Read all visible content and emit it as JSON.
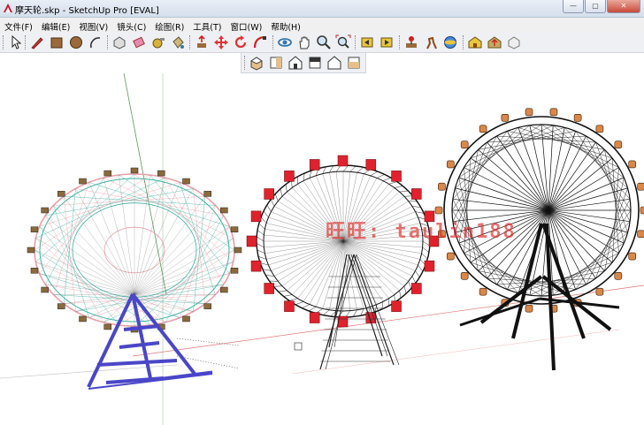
{
  "window": {
    "title": "摩天轮.skp - SketchUp Pro [EVAL]",
    "minimize": "—",
    "maximize": "▢",
    "close": "✕"
  },
  "menubar": [
    {
      "label": "文件(F)"
    },
    {
      "label": "编辑(E)"
    },
    {
      "label": "视图(V)"
    },
    {
      "label": "镜头(C)"
    },
    {
      "label": "绘图(R)"
    },
    {
      "label": "工具(T)"
    },
    {
      "label": "窗口(W)"
    },
    {
      "label": "帮助(H)"
    }
  ],
  "toolbar_icons": [
    "select-icon",
    "pencil-icon",
    "rectangle-icon",
    "circle-icon",
    "arc-icon",
    "make-component-icon",
    "eraser-icon",
    "tape-measure-icon",
    "paint-bucket-icon",
    "push-pull-icon",
    "move-icon",
    "rotate-icon",
    "follow-me-icon",
    "orbit-icon",
    "pan-icon",
    "zoom-icon",
    "zoom-extents-icon",
    "previous-view-icon",
    "next-view-icon",
    "position-camera-icon",
    "walk-icon",
    "look-around-icon",
    "get-models-icon",
    "share-model-icon",
    "share-component-icon"
  ],
  "views_toolbar_icons": [
    "iso-view-icon",
    "top-view-icon",
    "front-view-icon",
    "right-view-icon",
    "back-view-icon",
    "left-view-icon"
  ],
  "watermark": "旺旺: taulin188",
  "colors": {
    "titlebar": "#d5dfec",
    "wheel_left_pink": "#e8a0a8",
    "wheel_left_teal": "#3ab0a0",
    "wheel_left_base": "#4a46c8",
    "wheel_middle_cabin": "#e0222e",
    "wheel_right_cabin": "#d9884a"
  }
}
